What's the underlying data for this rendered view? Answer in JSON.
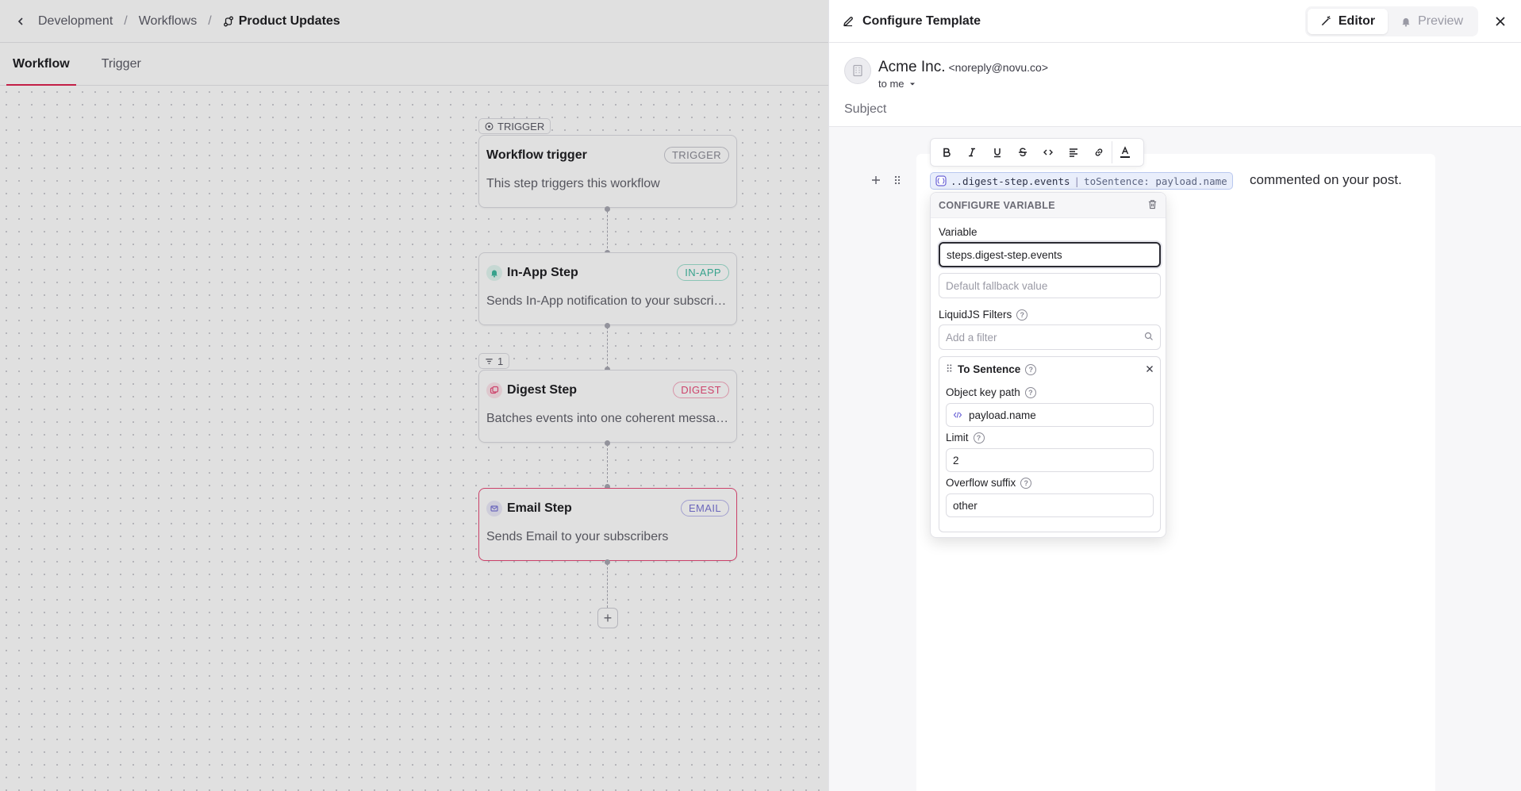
{
  "breadcrumb": {
    "items": [
      "Development",
      "Workflows"
    ],
    "current": "Product Updates"
  },
  "tabs": [
    {
      "label": "Workflow",
      "active": true
    },
    {
      "label": "Trigger",
      "active": false
    }
  ],
  "nodes": {
    "trigger_tag": "TRIGGER",
    "trigger": {
      "title": "Workflow trigger",
      "badge": "TRIGGER",
      "desc": "This step triggers this workflow"
    },
    "inapp": {
      "title": "In-App Step",
      "badge": "IN-APP",
      "desc": "Sends In-App notification to your subscribers",
      "color": "#3fb9a0"
    },
    "digest_tag": "1",
    "digest": {
      "title": "Digest Step",
      "badge": "DIGEST",
      "desc": "Batches events into one coherent message",
      "color": "#e94d7a"
    },
    "email": {
      "title": "Email Step",
      "badge": "EMAIL",
      "desc": "Sends Email to your subscribers",
      "color": "#7b76d6"
    }
  },
  "panel": {
    "title": "Configure Template",
    "mode_editor": "Editor",
    "mode_preview": "Preview",
    "sender_name": "Acme Inc.",
    "sender_email": "<noreply@novu.co>",
    "recipient": "to me",
    "subject_placeholder": "Subject"
  },
  "editor": {
    "variable_pill": "..digest-step.events",
    "pipe": "|",
    "filter_pill": "toSentence: payload.name",
    "after_text": "commented on your post."
  },
  "configure_variable": {
    "header": "CONFIGURE VARIABLE",
    "variable_label": "Variable",
    "variable_value": "steps.digest-step.events",
    "fallback_placeholder": "Default fallback value",
    "filters_label": "LiquidJS Filters",
    "filter_search_placeholder": "Add a filter",
    "filter": {
      "name": "To Sentence",
      "object_key_label": "Object key path",
      "object_key_value": "payload.name",
      "limit_label": "Limit",
      "limit_value": "2",
      "overflow_label": "Overflow suffix",
      "overflow_value": "other"
    }
  }
}
